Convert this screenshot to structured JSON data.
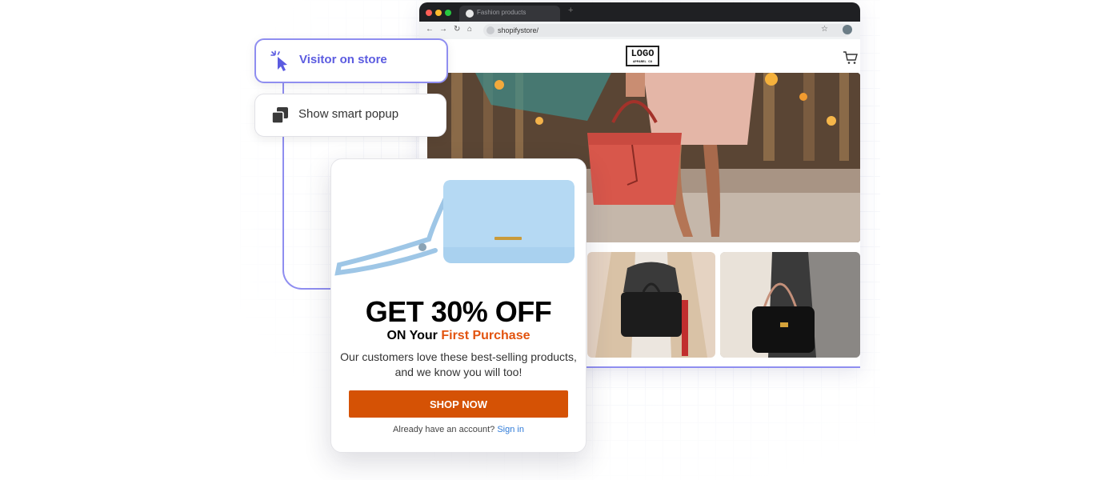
{
  "browser": {
    "tab_title": "Fashion products",
    "new_tab_symbol": "+",
    "url": "shopifystore/",
    "nav": {
      "back": "←",
      "forward": "→",
      "reload": "↻",
      "home": "⌂"
    },
    "bookmark_symbol": "☆"
  },
  "store": {
    "logo_text": "LOGO",
    "logo_subtext": "APPAREL CO"
  },
  "workflow": {
    "step1_label": "Visitor on store",
    "step2_label": "Show smart popup"
  },
  "popup": {
    "headline": "GET 30% OFF",
    "sub_prefix": "ON Your ",
    "sub_accent": "First Purchase",
    "body_line1": "Our customers love these best-selling products,",
    "body_line2": "and we know you will too!",
    "cta_label": "SHOP NOW",
    "account_prompt": "Already have an account?",
    "signin_label": "Sign in"
  },
  "colors": {
    "accent_purple": "#6f6ee8",
    "cta_orange": "#d55205",
    "accent_orange_text": "#e2530e",
    "link_blue": "#2f7bd8"
  },
  "icons": [
    "cursor-click-icon",
    "popup-windows-icon",
    "cart-icon",
    "lock-icon",
    "star-icon"
  ]
}
